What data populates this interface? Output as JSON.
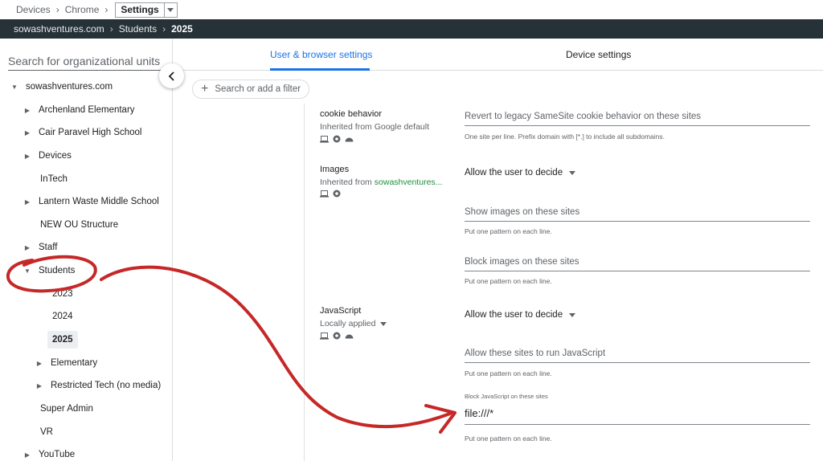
{
  "breadcrumb": {
    "items": [
      "Devices",
      "Chrome"
    ],
    "current": "Settings"
  },
  "ou_path": {
    "items": [
      "sowashventures.com",
      "Students"
    ],
    "current": "2025"
  },
  "sidebar": {
    "search_placeholder": "Search for organizational units",
    "tree": [
      {
        "label": "sowashventures.com",
        "expanded": true
      },
      {
        "label": "Archenland Elementary"
      },
      {
        "label": "Cair Paravel High School"
      },
      {
        "label": "Devices"
      },
      {
        "label": "InTech"
      },
      {
        "label": "Lantern Waste Middle School"
      },
      {
        "label": "NEW OU Structure"
      },
      {
        "label": "Staff"
      },
      {
        "label": "Students",
        "expanded": true
      },
      {
        "label": "2023"
      },
      {
        "label": "2024"
      },
      {
        "label": "2025",
        "selected": true
      },
      {
        "label": "Elementary"
      },
      {
        "label": "Restricted Tech (no media)"
      },
      {
        "label": "Super Admin"
      },
      {
        "label": "VR"
      },
      {
        "label": "YouTube"
      }
    ]
  },
  "tabs": [
    {
      "label": "User & browser settings",
      "active": true
    },
    {
      "label": "Device settings"
    }
  ],
  "filter": {
    "label": "Search or add a filter"
  },
  "settings": {
    "cookie": {
      "name": "cookie behavior",
      "inherited": "Inherited from Google default",
      "field_placeholder": "Revert to legacy SameSite cookie behavior on these sites",
      "hint": "One site per line. Prefix domain with [*.] to include all subdomains."
    },
    "images": {
      "name": "Images",
      "inherited_prefix": "Inherited from",
      "inherited_link": "sowashventures...",
      "select_value": "Allow the user to decide",
      "show_placeholder": "Show images on these sites",
      "show_hint": "Put one pattern on each line.",
      "block_placeholder": "Block images on these sites",
      "block_hint": "Put one pattern on each line."
    },
    "javascript": {
      "name": "JavaScript",
      "applied": "Locally applied",
      "select_value": "Allow the user to decide",
      "allow_placeholder": "Allow these sites to run JavaScript",
      "allow_hint": "Put one pattern on each line.",
      "block_label": "Block JavaScript on these sites",
      "block_value": "file:///*",
      "block_hint": "Put one pattern on each line."
    }
  },
  "colors": {
    "accent": "#1a73e8",
    "dark_bar": "#263238",
    "annotation": "#c62828",
    "link": "#1e8e3e"
  },
  "icons": [
    "chevron-left-icon",
    "plus-icon",
    "laptop-icon",
    "chrome-icon",
    "android-icon",
    "dropdown-caret-icon",
    "tree-triangle-icon"
  ]
}
